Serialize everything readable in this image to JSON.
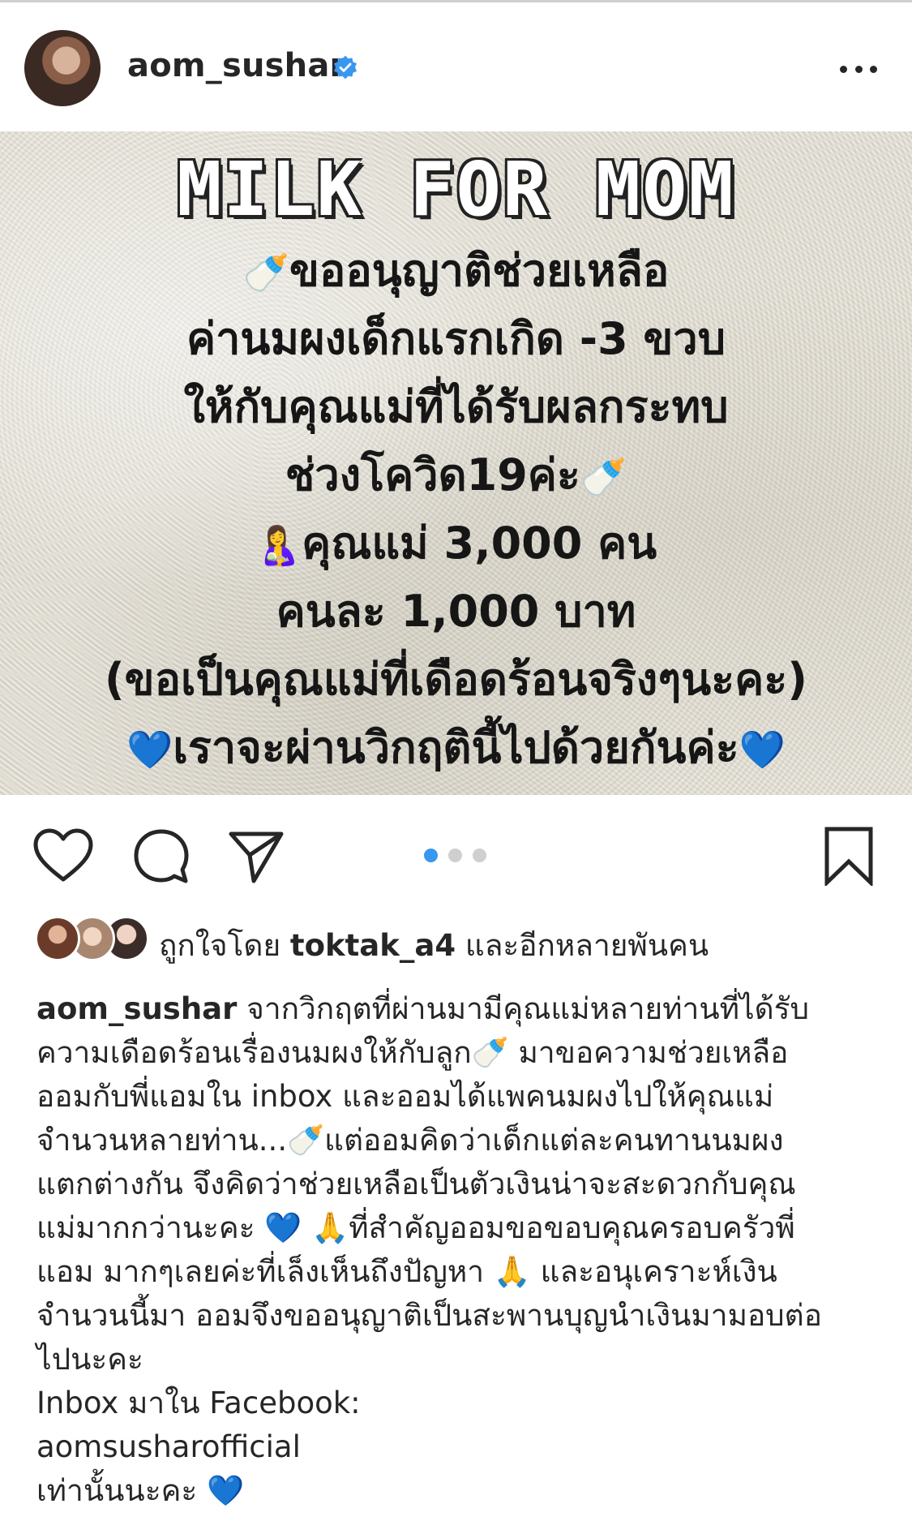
{
  "header": {
    "username": "aom_sushar"
  },
  "post_image": {
    "title": "MILK FOR MOM",
    "lines": [
      {
        "prefix": "🍼",
        "text": "ขออนุญาติช่วยเหลือ",
        "suffix": ""
      },
      {
        "prefix": "",
        "text": "ค่านมผงเด็กแรกเกิด -3 ขวบ",
        "suffix": ""
      },
      {
        "prefix": "",
        "text": "ให้กับคุณแม่ที่ได้รับผลกระทบ",
        "suffix": ""
      },
      {
        "prefix": "",
        "text": "ช่วงโควิด19ค่ะ",
        "suffix": "🍼"
      },
      {
        "prefix": "🤱",
        "text": "คุณแม่ 3,000 คน",
        "suffix": ""
      },
      {
        "prefix": "",
        "text": "คนละ 1,000 บาท",
        "suffix": ""
      },
      {
        "prefix": "",
        "text": "(ขอเป็นคุณแม่ที่เดือดร้อนจริงๆนะคะ)",
        "suffix": ""
      },
      {
        "prefix": "💙",
        "text": "เราจะผ่านวิกฤตินี้ไปด้วยกันค่ะ",
        "suffix": "💙"
      }
    ]
  },
  "carousel": {
    "count": 3,
    "active": 1
  },
  "likes": {
    "prefix": "ถูกใจโดย",
    "user": "toktak_a4",
    "suffix": "และอีกหลายพันคน"
  },
  "caption": {
    "username": "aom_sushar",
    "first_line": "จากวิกฤตที่ผ่านมามีคุณแม่หลายท่านที่ได้รับ",
    "lines": [
      "ความเดือดร้อนเรื่องนมผงให้กับลูก🍼  มาขอความช่วยเหลือ",
      "ออมกับพี่แอมใน inbox และออมได้แพคนมผงไปให้คุณแม่",
      "จำนวนหลายท่าน...🍼แต่ออมคิดว่าเด็กแต่ละคนทานนมผง",
      "แตกต่างกัน จึงคิดว่าช่วยเหลือเป็นตัวเงินน่าจะสะดวกกับคุณ",
      "แม่มากกว่านะคะ 💙 🙏ที่สำคัญออมขอขอบคุณครอบครัวพี่",
      "แอม มากๆเลยค่ะที่เล็งเห็นถึงปัญหา 🙏 และอนุเคราะห์เงิน",
      "จำนวนนี้มา ออมจึงขออนุญาติเป็นสะพานบุญนำเงินมามอบต่อ",
      "ไปนะคะ",
      "Inbox มาใน Facebook:",
      "aomsusharofficial",
      "เท่านั้นนะคะ 💙"
    ]
  },
  "colors": {
    "text": "#262626",
    "accent_blue": "#3897f0",
    "verified_blue": "#3897f0",
    "dot_inactive": "#cfcfcf"
  },
  "icons": [
    "more-options-icon",
    "verified-badge-icon",
    "heart-icon",
    "comment-icon",
    "share-icon",
    "bookmark-icon"
  ]
}
